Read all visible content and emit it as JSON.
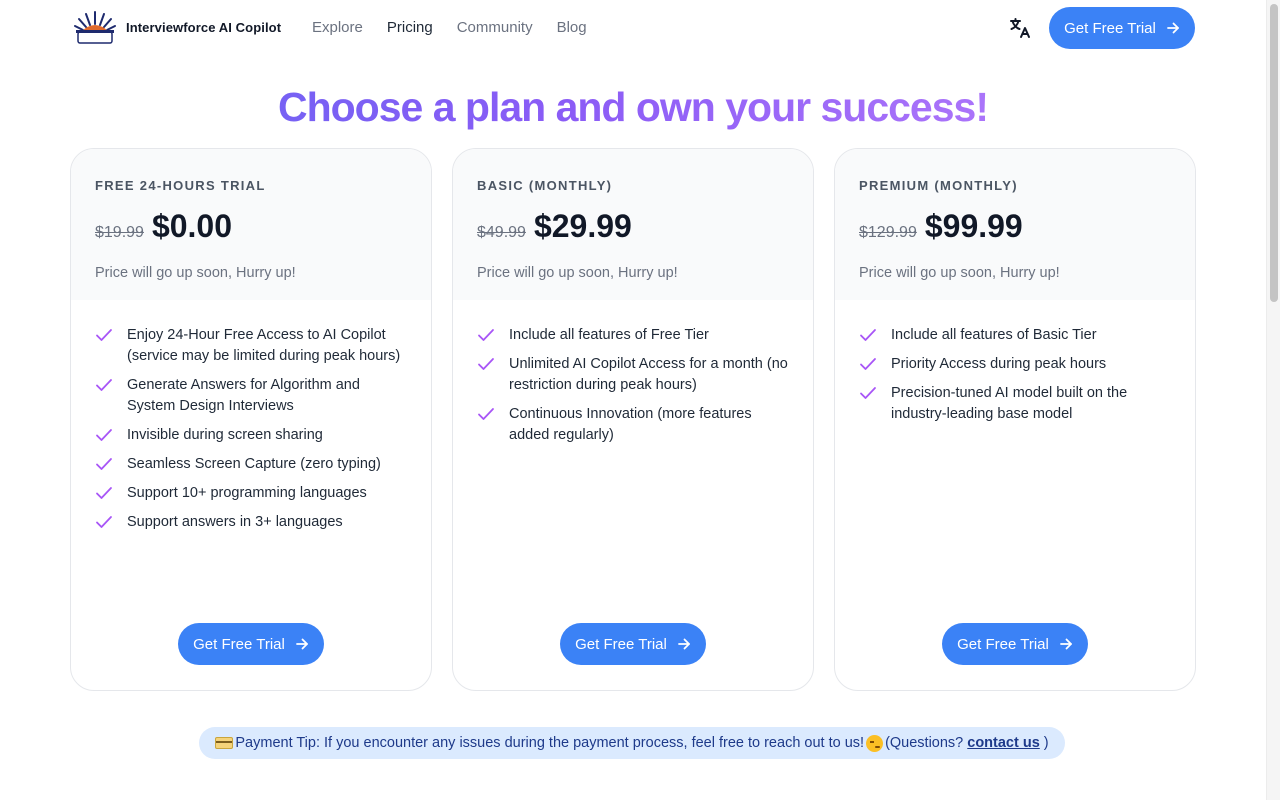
{
  "header": {
    "brand": "Interviewforce AI Copilot",
    "nav": [
      {
        "label": "Explore",
        "active": false
      },
      {
        "label": "Pricing",
        "active": true
      },
      {
        "label": "Community",
        "active": false
      },
      {
        "label": "Blog",
        "active": false
      }
    ],
    "language_icon": "translate-icon",
    "cta_label": "Get Free Trial"
  },
  "hero": {
    "title": "Choose a plan and own your success!"
  },
  "plans": [
    {
      "tier": "FREE 24-HOURS TRIAL",
      "old_price": "$19.99",
      "price": "$0.00",
      "note": "Price will go up soon, Hurry up!",
      "features": [
        "Enjoy 24-Hour Free Access to AI Copilot (service may be limited during peak hours)",
        "Generate Answers for Algorithm and System Design Interviews",
        "Invisible during screen sharing",
        "Seamless Screen Capture (zero typing)",
        "Support 10+ programming languages",
        "Support answers in 3+ languages"
      ],
      "cta_label": "Get Free Trial"
    },
    {
      "tier": "BASIC (MONTHLY)",
      "old_price": "$49.99",
      "price": "$29.99",
      "note": "Price will go up soon, Hurry up!",
      "features": [
        "Include all features of Free Tier",
        "Unlimited AI Copilot Access for a month (no restriction during peak hours)",
        "Continuous Innovation (more features added regularly)"
      ],
      "cta_label": "Get Free Trial"
    },
    {
      "tier": "PREMIUM (MONTHLY)",
      "old_price": "$129.99",
      "price": "$99.99",
      "note": "Price will go up soon, Hurry up!",
      "features": [
        "Include all features of Basic Tier",
        "Priority Access during peak hours",
        "Precision-tuned AI model built on the industry-leading base model"
      ],
      "cta_label": "Get Free Trial"
    }
  ],
  "tip": {
    "text": "Payment Tip: If you encounter any issues during the payment process, feel free to reach out to us!",
    "questions_prefix": "(Questions?",
    "link_label": "contact us",
    "questions_suffix": ")"
  },
  "colors": {
    "accent": "#3b82f6",
    "check": "#a855f7",
    "tip_background": "#dbeafe"
  }
}
